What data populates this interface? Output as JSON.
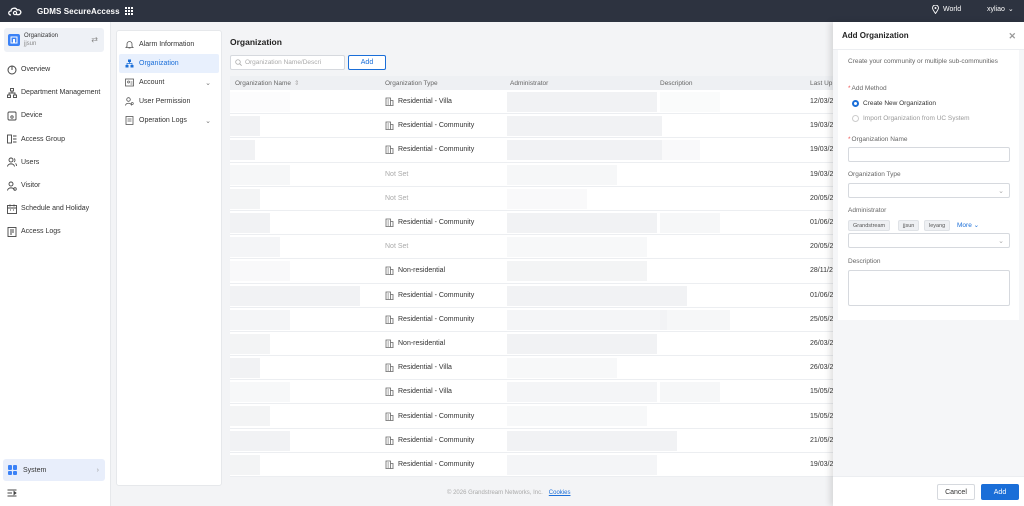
{
  "topbar": {
    "app_title": "GDMS SecureAccess",
    "region": "World",
    "user": "xyliao"
  },
  "sidebar": {
    "org_label": "Organization",
    "org_name": "jjsun",
    "items": [
      {
        "label": "Overview",
        "icon": "circle-icon"
      },
      {
        "label": "Department Management",
        "icon": "org-chart-icon"
      },
      {
        "label": "Device",
        "icon": "device-icon"
      },
      {
        "label": "Access Group",
        "icon": "access-group-icon"
      },
      {
        "label": "Users",
        "icon": "users-icon"
      },
      {
        "label": "Visitor",
        "icon": "visitor-icon"
      },
      {
        "label": "Schedule and Holiday",
        "icon": "calendar-icon"
      },
      {
        "label": "Access Logs",
        "icon": "log-icon"
      }
    ],
    "system_label": "System"
  },
  "submenu": {
    "items": [
      {
        "label": "Alarm Information",
        "icon": "bell-icon"
      },
      {
        "label": "Organization",
        "icon": "org-icon"
      },
      {
        "label": "Account",
        "icon": "account-icon"
      },
      {
        "label": "User Permission",
        "icon": "user-permission-icon"
      },
      {
        "label": "Operation Logs",
        "icon": "file-icon"
      }
    ]
  },
  "main": {
    "title": "Organization",
    "search_placeholder": "Organization Name/Descri",
    "add_label": "Add",
    "columns": [
      "Organization Name",
      "Organization Type",
      "Administrator",
      "Description",
      "Last Up"
    ],
    "rows": [
      {
        "type": "Residential - Villa",
        "date": "12/03/2"
      },
      {
        "type": "Residential - Community",
        "date": "19/03/2"
      },
      {
        "type": "Residential - Community",
        "date": "19/03/2"
      },
      {
        "type": "Not Set",
        "date": "19/03/2"
      },
      {
        "type": "Not Set",
        "date": "20/05/2"
      },
      {
        "type": "Residential - Community",
        "date": "01/06/2"
      },
      {
        "type": "Not Set",
        "date": "20/05/2"
      },
      {
        "type": "Non-residential",
        "date": "28/11/2"
      },
      {
        "type": "Residential - Community",
        "date": "01/06/2"
      },
      {
        "type": "Residential - Community",
        "date": "25/05/2"
      },
      {
        "type": "Non-residential",
        "date": "26/03/2"
      },
      {
        "type": "Residential - Villa",
        "date": "26/03/2"
      },
      {
        "type": "Residential - Villa",
        "date": "15/05/2"
      },
      {
        "type": "Residential - Community",
        "date": "15/05/2"
      },
      {
        "type": "Residential - Community",
        "date": "21/05/2"
      },
      {
        "type": "Residential - Community",
        "date": "19/03/2"
      }
    ],
    "footer_text": "© 2026 Grandstream Networks, Inc.",
    "footer_link": "Cookies"
  },
  "drawer": {
    "title": "Add Organization",
    "description": "Create your community or multiple sub-communities",
    "add_method_label": "Add Method",
    "option_create": "Create New Organization",
    "option_import": "Import Organization from UC System",
    "org_name_label": "Organization Name",
    "org_type_label": "Organization Type",
    "admin_label": "Administrator",
    "admin_tags": [
      "Grandstream",
      "jjsun",
      "leyang"
    ],
    "more_label": "More",
    "description_label": "Description",
    "cancel_label": "Cancel",
    "add_label": "Add"
  },
  "colors": {
    "accent": "#1a6ed8",
    "topbar": "#2d3340"
  }
}
